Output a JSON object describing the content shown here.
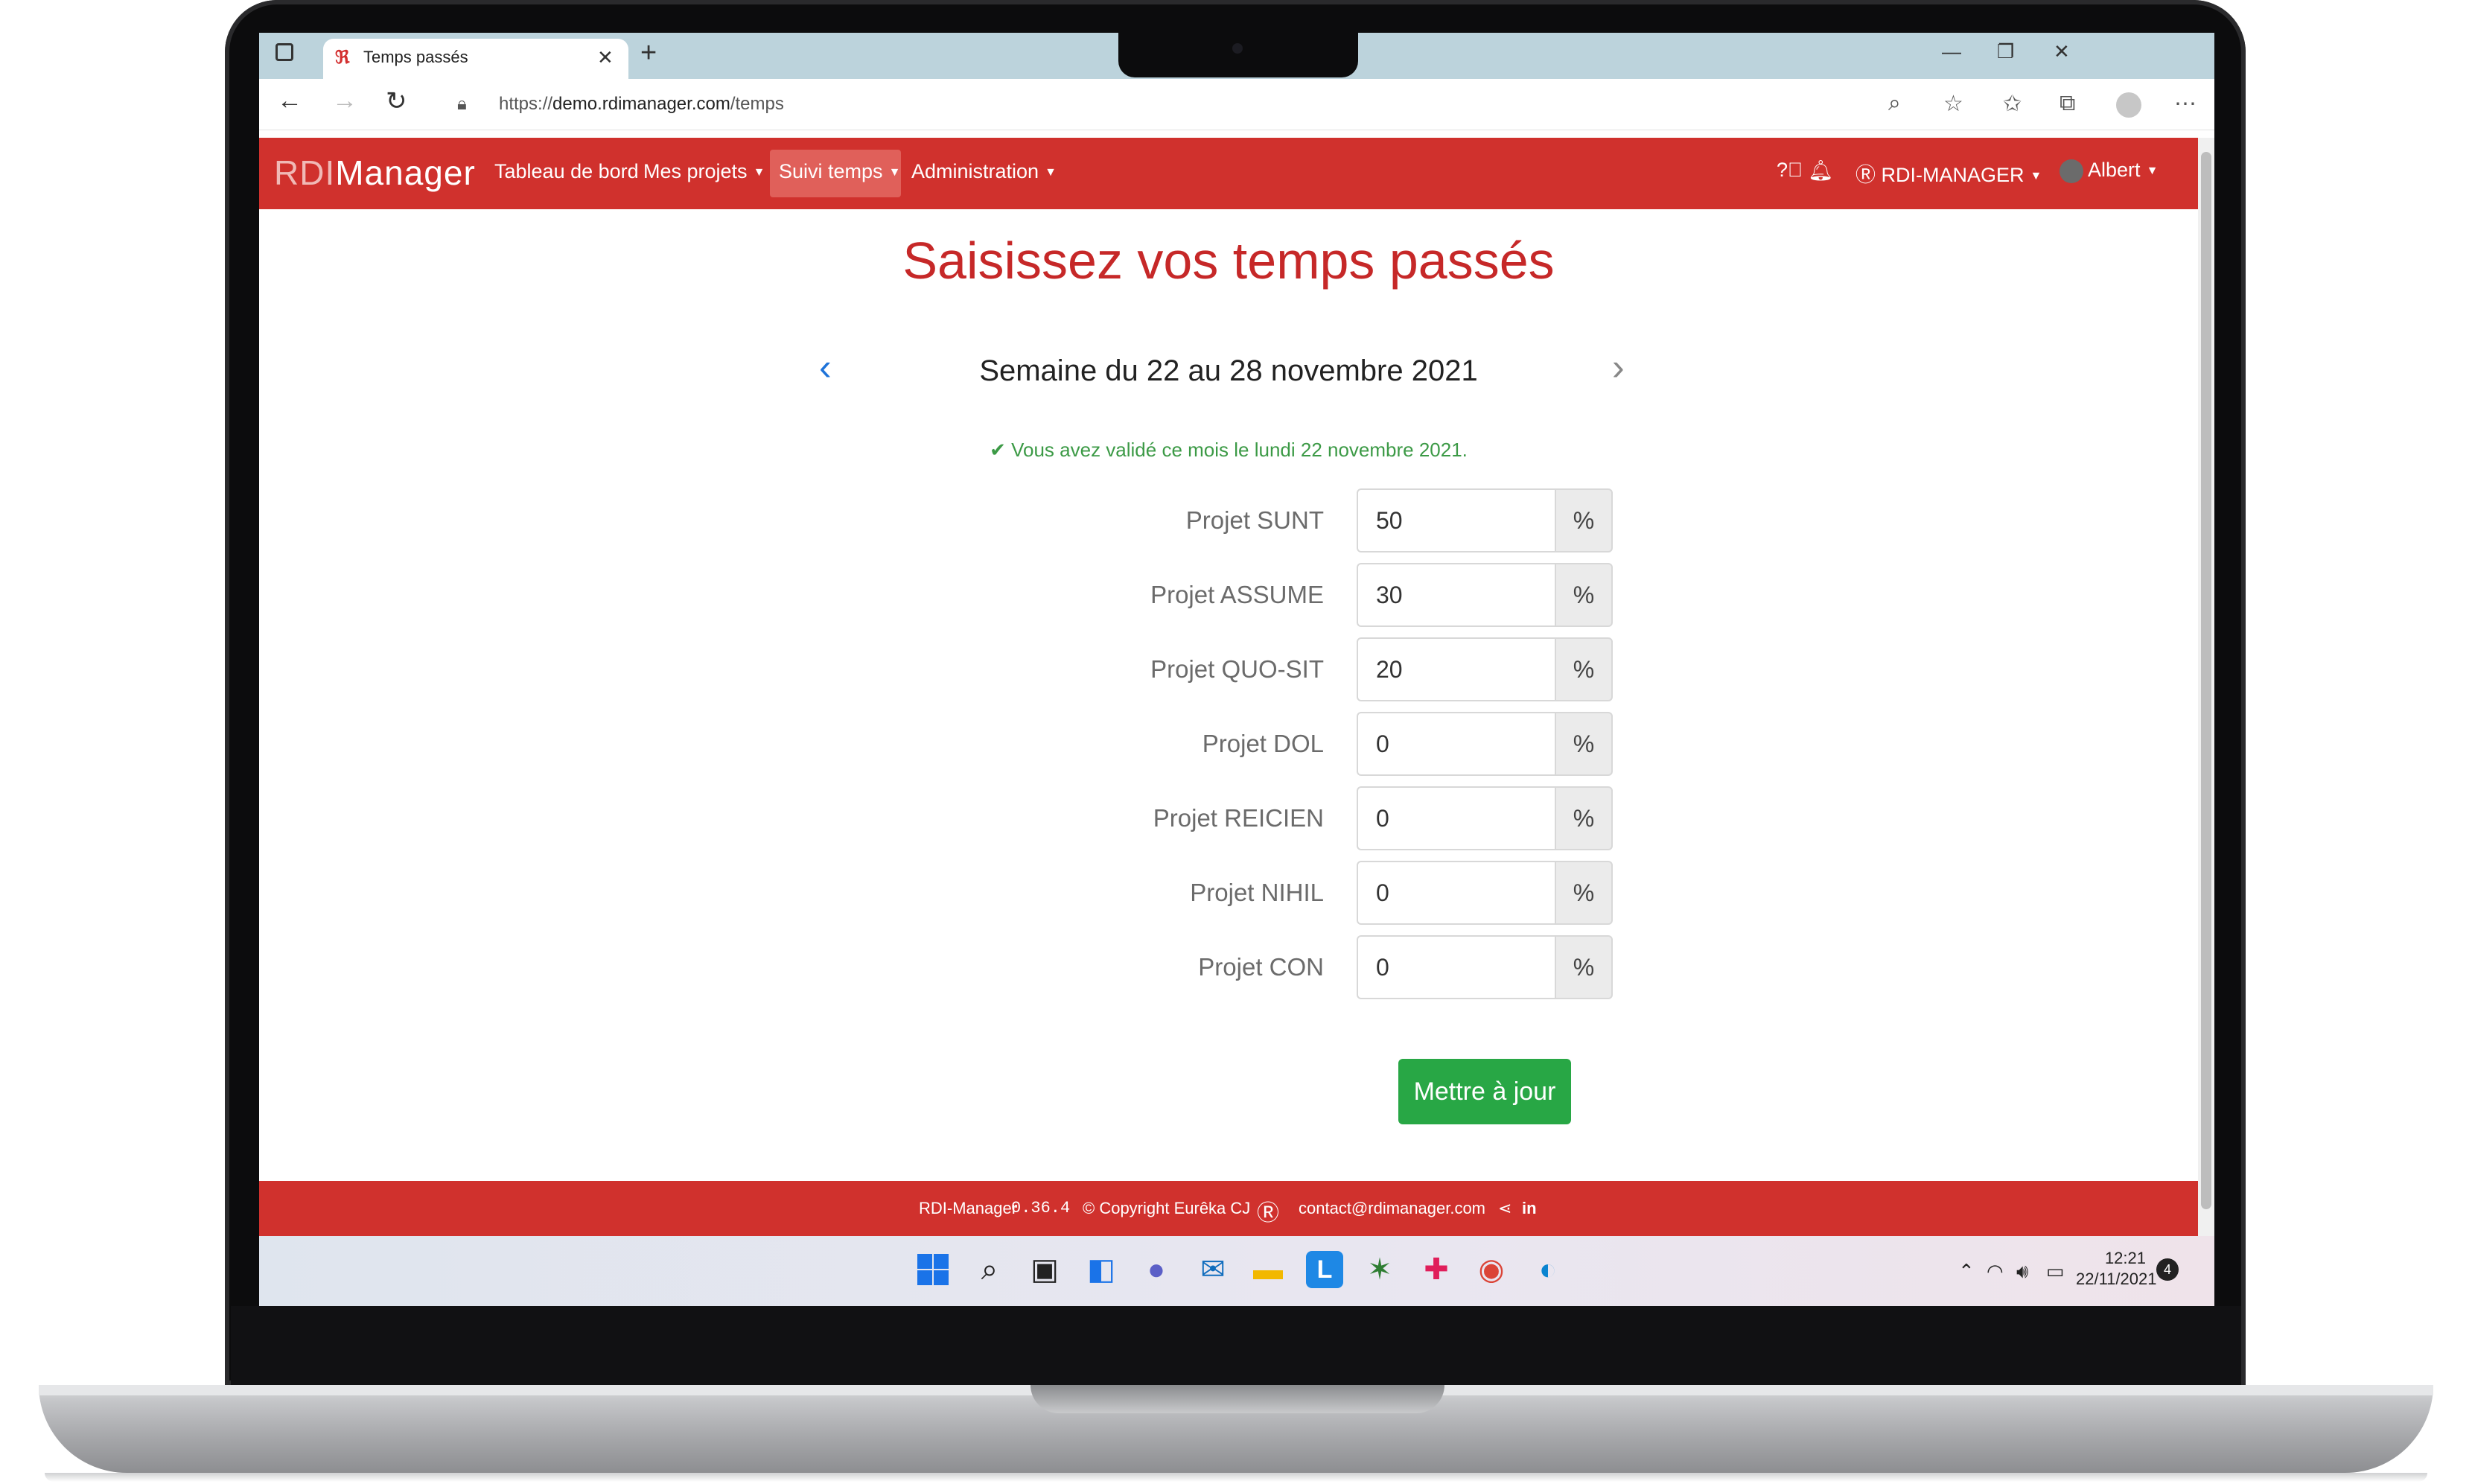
{
  "browser": {
    "tab_title": "Temps passés",
    "url_scheme": "https://",
    "url_host": "demo.rdimanager.com",
    "url_path": "/temps"
  },
  "app": {
    "logo_rdi": "RDI",
    "logo_manager": "Manager",
    "nav": {
      "dashboard": "Tableau de bord",
      "projects": "Mes projets",
      "time": "Suivi temps",
      "admin": "Administration"
    },
    "org": "RDI-MANAGER",
    "user": "Albert"
  },
  "page": {
    "title": "Saisissez vos temps passés",
    "week": "Semaine du 22 au 28 novembre 2021",
    "validation_notice": "Vous avez validé ce mois le lundi 22 novembre 2021.",
    "percent_symbol": "%",
    "submit_label": "Mettre à jour",
    "rows": [
      {
        "label": "Projet SUNT",
        "value": "50"
      },
      {
        "label": "Projet ASSUME",
        "value": "30"
      },
      {
        "label": "Projet QUO-SIT",
        "value": "20"
      },
      {
        "label": "Projet DOL",
        "value": "0"
      },
      {
        "label": "Projet REICIEN",
        "value": "0"
      },
      {
        "label": "Projet NIHIL",
        "value": "0"
      },
      {
        "label": "Projet CON",
        "value": "0"
      }
    ]
  },
  "footer": {
    "app_name": "RDI-Manager",
    "version": "0.36.4",
    "copyright": "© Copyright Eurêka CJ",
    "email": "contact@rdimanager.com",
    "linkedin": "in"
  },
  "taskbar": {
    "time": "12:21",
    "date": "22/11/2021",
    "notification_count": "4"
  },
  "colors": {
    "brand_red": "#d0312d",
    "title_red": "#c62828",
    "success_green": "#28a745"
  }
}
